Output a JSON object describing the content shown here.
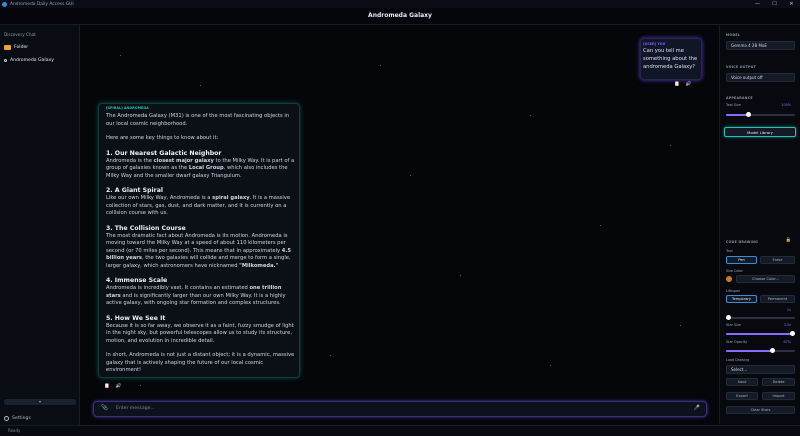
{
  "window": {
    "app_title": "Andromeda Daily Access GUI",
    "controls": [
      "—",
      "☐",
      "✕"
    ]
  },
  "header": {
    "title": "Andromeda Galaxy"
  },
  "sidebar": {
    "top_item": "Discovery Chat",
    "folder": "Folder",
    "chat_item": "Andromeda Galaxy",
    "bottom_button": "▾",
    "settings": "Settings"
  },
  "status": {
    "text": "Ready"
  },
  "chat": {
    "user": {
      "role": "[USER] YOU",
      "text": "Can you tell me something about the andromeda Galaxy?"
    },
    "ai": {
      "role": "[SPIRAL] ANDROMEDA",
      "intro": "The Andromeda Galaxy (M31) is one of the most fascinating objects in our local cosmic neighborhood.",
      "lead": "Here are some key things to know about it:",
      "sections": [
        {
          "heading": "1. Our Nearest Galactic Neighbor",
          "p1": "Andromeda is the ",
          "b1": "closest major galaxy",
          "p2": " to the Milky Way. It is part of a group of galaxies known as the ",
          "b2": "Local Group",
          "p3": ", which also includes the Milky Way and the smaller dwarf galaxy Triangulum."
        },
        {
          "heading": "2. A Giant Spiral",
          "p1": "Like our own Milky Way, Andromeda is a ",
          "b1": "spiral galaxy",
          "p2": ". It is a massive collection of stars, gas, dust, and dark matter, and it is currently on a collision course with us."
        },
        {
          "heading": "3. The Collision Course",
          "p1": "The most dramatic fact about Andromeda is its motion. Andromeda is moving toward the Milky Way at a speed of about 110 kilometers per second (or 70 miles per second). This means that in approximately ",
          "b1": "4.5 billion years",
          "p2": ", the two galaxies will collide and merge to form a single, larger galaxy, which astronomers have nicknamed ",
          "b2": "\"Milkomeda.\""
        },
        {
          "heading": "4. Immense Scale",
          "p1": "Andromeda is incredibly vast. It contains an estimated ",
          "b1": "one trillion stars",
          "p2": " and is significantly larger than our own Milky Way. It is a highly active galaxy, with ongoing star formation and complex structures."
        },
        {
          "heading": "5. How We See It",
          "p1": "Because it is so far away, we observe it as a faint, fuzzy smudge of light in the night sky, but powerful telescopes allow us to study its structure, motion, and evolution in incredible detail."
        }
      ],
      "closing": "In short, Andromeda is not just a distant object; it is a dynamic, massive galaxy that is actively shaping the future of our local cosmic environment!"
    },
    "actions": {
      "copy": "📋",
      "speak": "🔊"
    }
  },
  "input": {
    "placeholder": "Enter message...",
    "clip": "📎",
    "mic": "🎤"
  },
  "panel": {
    "model_label": "MODEL",
    "model_value": "Gemma 4 2B MoE",
    "voice_label": "VOICE OUTPUT",
    "voice_value": "Voice output off",
    "appearance_label": "APPEARANCE",
    "text_size_label": "Text Size",
    "text_size_value": "100%",
    "text_size_level": 0.33,
    "model_library_button": "Model Library",
    "code_drawing_label": "CODE DRAWING",
    "lock_icon": "🔒",
    "tool_label": "Tool",
    "tool_pen": "Pen",
    "tool_erase": "Erase",
    "size_color_label": "Size Color",
    "color_button": "Choose Color...",
    "lifespan_label": "Lifespan",
    "temporary": "Temporary",
    "permanent": "Permanent",
    "size_value": "1x",
    "size_level": 0.03,
    "star_size_label": "Star Size",
    "star_size_value": "3.0x",
    "star_size_level": 1.0,
    "star_opacity_label": "Star Opacity",
    "star_opacity_value": "67%",
    "star_opacity_level": 0.67,
    "load_drawing_label": "Load Drawing",
    "load_select": "Select...",
    "save": "Save",
    "delete": "Delete",
    "export": "Export",
    "import": "Import",
    "clear": "Clear Stars"
  },
  "colors": {
    "accent_teal": "#26bfb2",
    "accent_purple": "#8a6bff",
    "background": "#04060a"
  }
}
